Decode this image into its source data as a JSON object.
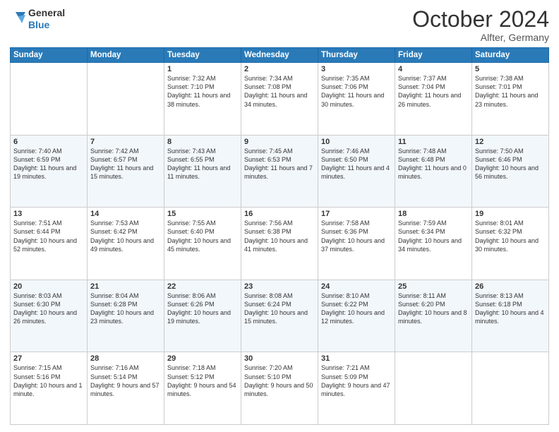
{
  "header": {
    "logo_line1": "General",
    "logo_line2": "Blue",
    "month": "October 2024",
    "location": "Alfter, Germany"
  },
  "days_of_week": [
    "Sunday",
    "Monday",
    "Tuesday",
    "Wednesday",
    "Thursday",
    "Friday",
    "Saturday"
  ],
  "weeks": [
    [
      {
        "num": "",
        "detail": ""
      },
      {
        "num": "",
        "detail": ""
      },
      {
        "num": "1",
        "detail": "Sunrise: 7:32 AM\nSunset: 7:10 PM\nDaylight: 11 hours and 38 minutes."
      },
      {
        "num": "2",
        "detail": "Sunrise: 7:34 AM\nSunset: 7:08 PM\nDaylight: 11 hours and 34 minutes."
      },
      {
        "num": "3",
        "detail": "Sunrise: 7:35 AM\nSunset: 7:06 PM\nDaylight: 11 hours and 30 minutes."
      },
      {
        "num": "4",
        "detail": "Sunrise: 7:37 AM\nSunset: 7:04 PM\nDaylight: 11 hours and 26 minutes."
      },
      {
        "num": "5",
        "detail": "Sunrise: 7:38 AM\nSunset: 7:01 PM\nDaylight: 11 hours and 23 minutes."
      }
    ],
    [
      {
        "num": "6",
        "detail": "Sunrise: 7:40 AM\nSunset: 6:59 PM\nDaylight: 11 hours and 19 minutes."
      },
      {
        "num": "7",
        "detail": "Sunrise: 7:42 AM\nSunset: 6:57 PM\nDaylight: 11 hours and 15 minutes."
      },
      {
        "num": "8",
        "detail": "Sunrise: 7:43 AM\nSunset: 6:55 PM\nDaylight: 11 hours and 11 minutes."
      },
      {
        "num": "9",
        "detail": "Sunrise: 7:45 AM\nSunset: 6:53 PM\nDaylight: 11 hours and 7 minutes."
      },
      {
        "num": "10",
        "detail": "Sunrise: 7:46 AM\nSunset: 6:50 PM\nDaylight: 11 hours and 4 minutes."
      },
      {
        "num": "11",
        "detail": "Sunrise: 7:48 AM\nSunset: 6:48 PM\nDaylight: 11 hours and 0 minutes."
      },
      {
        "num": "12",
        "detail": "Sunrise: 7:50 AM\nSunset: 6:46 PM\nDaylight: 10 hours and 56 minutes."
      }
    ],
    [
      {
        "num": "13",
        "detail": "Sunrise: 7:51 AM\nSunset: 6:44 PM\nDaylight: 10 hours and 52 minutes."
      },
      {
        "num": "14",
        "detail": "Sunrise: 7:53 AM\nSunset: 6:42 PM\nDaylight: 10 hours and 49 minutes."
      },
      {
        "num": "15",
        "detail": "Sunrise: 7:55 AM\nSunset: 6:40 PM\nDaylight: 10 hours and 45 minutes."
      },
      {
        "num": "16",
        "detail": "Sunrise: 7:56 AM\nSunset: 6:38 PM\nDaylight: 10 hours and 41 minutes."
      },
      {
        "num": "17",
        "detail": "Sunrise: 7:58 AM\nSunset: 6:36 PM\nDaylight: 10 hours and 37 minutes."
      },
      {
        "num": "18",
        "detail": "Sunrise: 7:59 AM\nSunset: 6:34 PM\nDaylight: 10 hours and 34 minutes."
      },
      {
        "num": "19",
        "detail": "Sunrise: 8:01 AM\nSunset: 6:32 PM\nDaylight: 10 hours and 30 minutes."
      }
    ],
    [
      {
        "num": "20",
        "detail": "Sunrise: 8:03 AM\nSunset: 6:30 PM\nDaylight: 10 hours and 26 minutes."
      },
      {
        "num": "21",
        "detail": "Sunrise: 8:04 AM\nSunset: 6:28 PM\nDaylight: 10 hours and 23 minutes."
      },
      {
        "num": "22",
        "detail": "Sunrise: 8:06 AM\nSunset: 6:26 PM\nDaylight: 10 hours and 19 minutes."
      },
      {
        "num": "23",
        "detail": "Sunrise: 8:08 AM\nSunset: 6:24 PM\nDaylight: 10 hours and 15 minutes."
      },
      {
        "num": "24",
        "detail": "Sunrise: 8:10 AM\nSunset: 6:22 PM\nDaylight: 10 hours and 12 minutes."
      },
      {
        "num": "25",
        "detail": "Sunrise: 8:11 AM\nSunset: 6:20 PM\nDaylight: 10 hours and 8 minutes."
      },
      {
        "num": "26",
        "detail": "Sunrise: 8:13 AM\nSunset: 6:18 PM\nDaylight: 10 hours and 4 minutes."
      }
    ],
    [
      {
        "num": "27",
        "detail": "Sunrise: 7:15 AM\nSunset: 5:16 PM\nDaylight: 10 hours and 1 minute."
      },
      {
        "num": "28",
        "detail": "Sunrise: 7:16 AM\nSunset: 5:14 PM\nDaylight: 9 hours and 57 minutes."
      },
      {
        "num": "29",
        "detail": "Sunrise: 7:18 AM\nSunset: 5:12 PM\nDaylight: 9 hours and 54 minutes."
      },
      {
        "num": "30",
        "detail": "Sunrise: 7:20 AM\nSunset: 5:10 PM\nDaylight: 9 hours and 50 minutes."
      },
      {
        "num": "31",
        "detail": "Sunrise: 7:21 AM\nSunset: 5:09 PM\nDaylight: 9 hours and 47 minutes."
      },
      {
        "num": "",
        "detail": ""
      },
      {
        "num": "",
        "detail": ""
      }
    ]
  ]
}
